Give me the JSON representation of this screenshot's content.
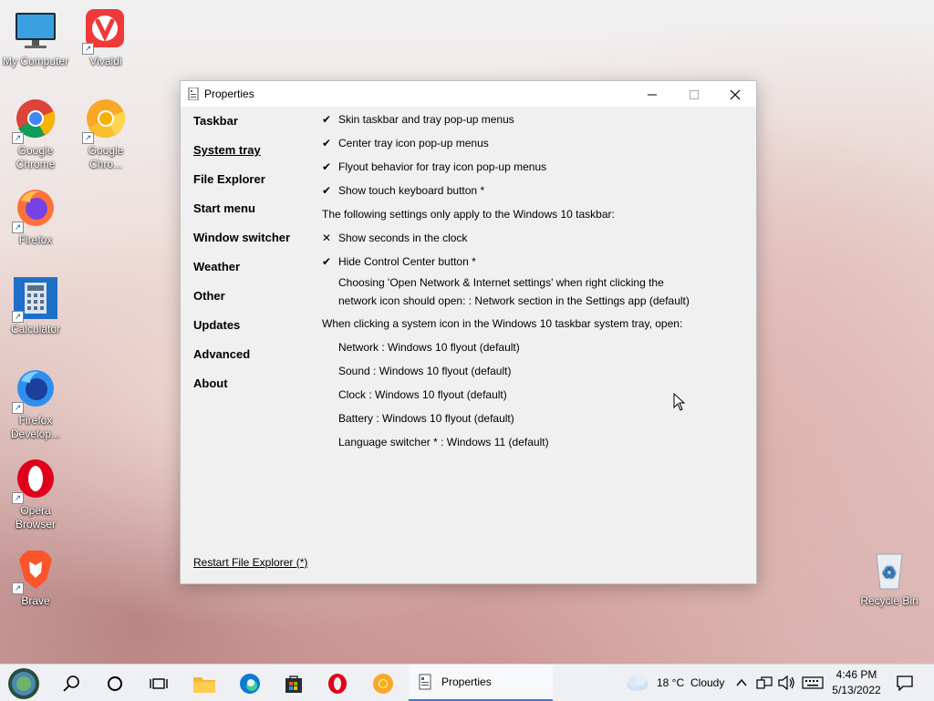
{
  "desktop": {
    "icons": [
      {
        "label": "My Computer"
      },
      {
        "label": "Vivaldi"
      },
      {
        "label": "Google Chrome"
      },
      {
        "label": "Google Chro..."
      },
      {
        "label": "Firefox"
      },
      {
        "label": "Calculator"
      },
      {
        "label": "Firefox Develop..."
      },
      {
        "label": "Opera Browser"
      },
      {
        "label": "Brave"
      },
      {
        "label": "Recycle Bin"
      }
    ]
  },
  "window": {
    "title": "Properties",
    "nav": [
      {
        "label": "Taskbar"
      },
      {
        "label": "System tray"
      },
      {
        "label": "File Explorer"
      },
      {
        "label": "Start menu"
      },
      {
        "label": "Window switcher"
      },
      {
        "label": "Weather"
      },
      {
        "label": "Other"
      },
      {
        "label": "Updates"
      },
      {
        "label": "Advanced"
      },
      {
        "label": "About"
      }
    ],
    "active_nav": "System tray",
    "settings": [
      {
        "mark": "✔",
        "text": "Skin taskbar and tray pop-up menus"
      },
      {
        "mark": "✔",
        "text": "Center tray icon pop-up menus"
      },
      {
        "mark": "✔",
        "text": "Flyout behavior for tray icon pop-up menus"
      },
      {
        "mark": "✔",
        "text": "Show touch keyboard button *"
      },
      {
        "mark": "",
        "text": "The following settings only apply to the Windows 10 taskbar:"
      },
      {
        "mark": "✕",
        "text": "Show seconds in the clock"
      },
      {
        "mark": "✔",
        "text": "Hide Control Center button *"
      }
    ],
    "network_setting": {
      "line1": "Choosing 'Open Network & Internet settings' when right clicking the",
      "line2": "network icon should open: : Network section in the Settings app (default)"
    },
    "tray_heading": "When clicking a system icon in the Windows 10 taskbar system tray, open:",
    "tray_options": [
      "Network : Windows 10 flyout (default)",
      "Sound : Windows 10 flyout (default)",
      "Clock : Windows 10 flyout (default)",
      "Battery : Windows 10 flyout (default)",
      "Language switcher * : Windows 11 (default)"
    ],
    "restart_link": "Restart File Explorer (*)"
  },
  "taskbar": {
    "active_app_label": "Properties",
    "weather_temp": "18 °C",
    "weather_cond": "Cloudy",
    "time": "4:46 PM",
    "date": "5/13/2022"
  }
}
